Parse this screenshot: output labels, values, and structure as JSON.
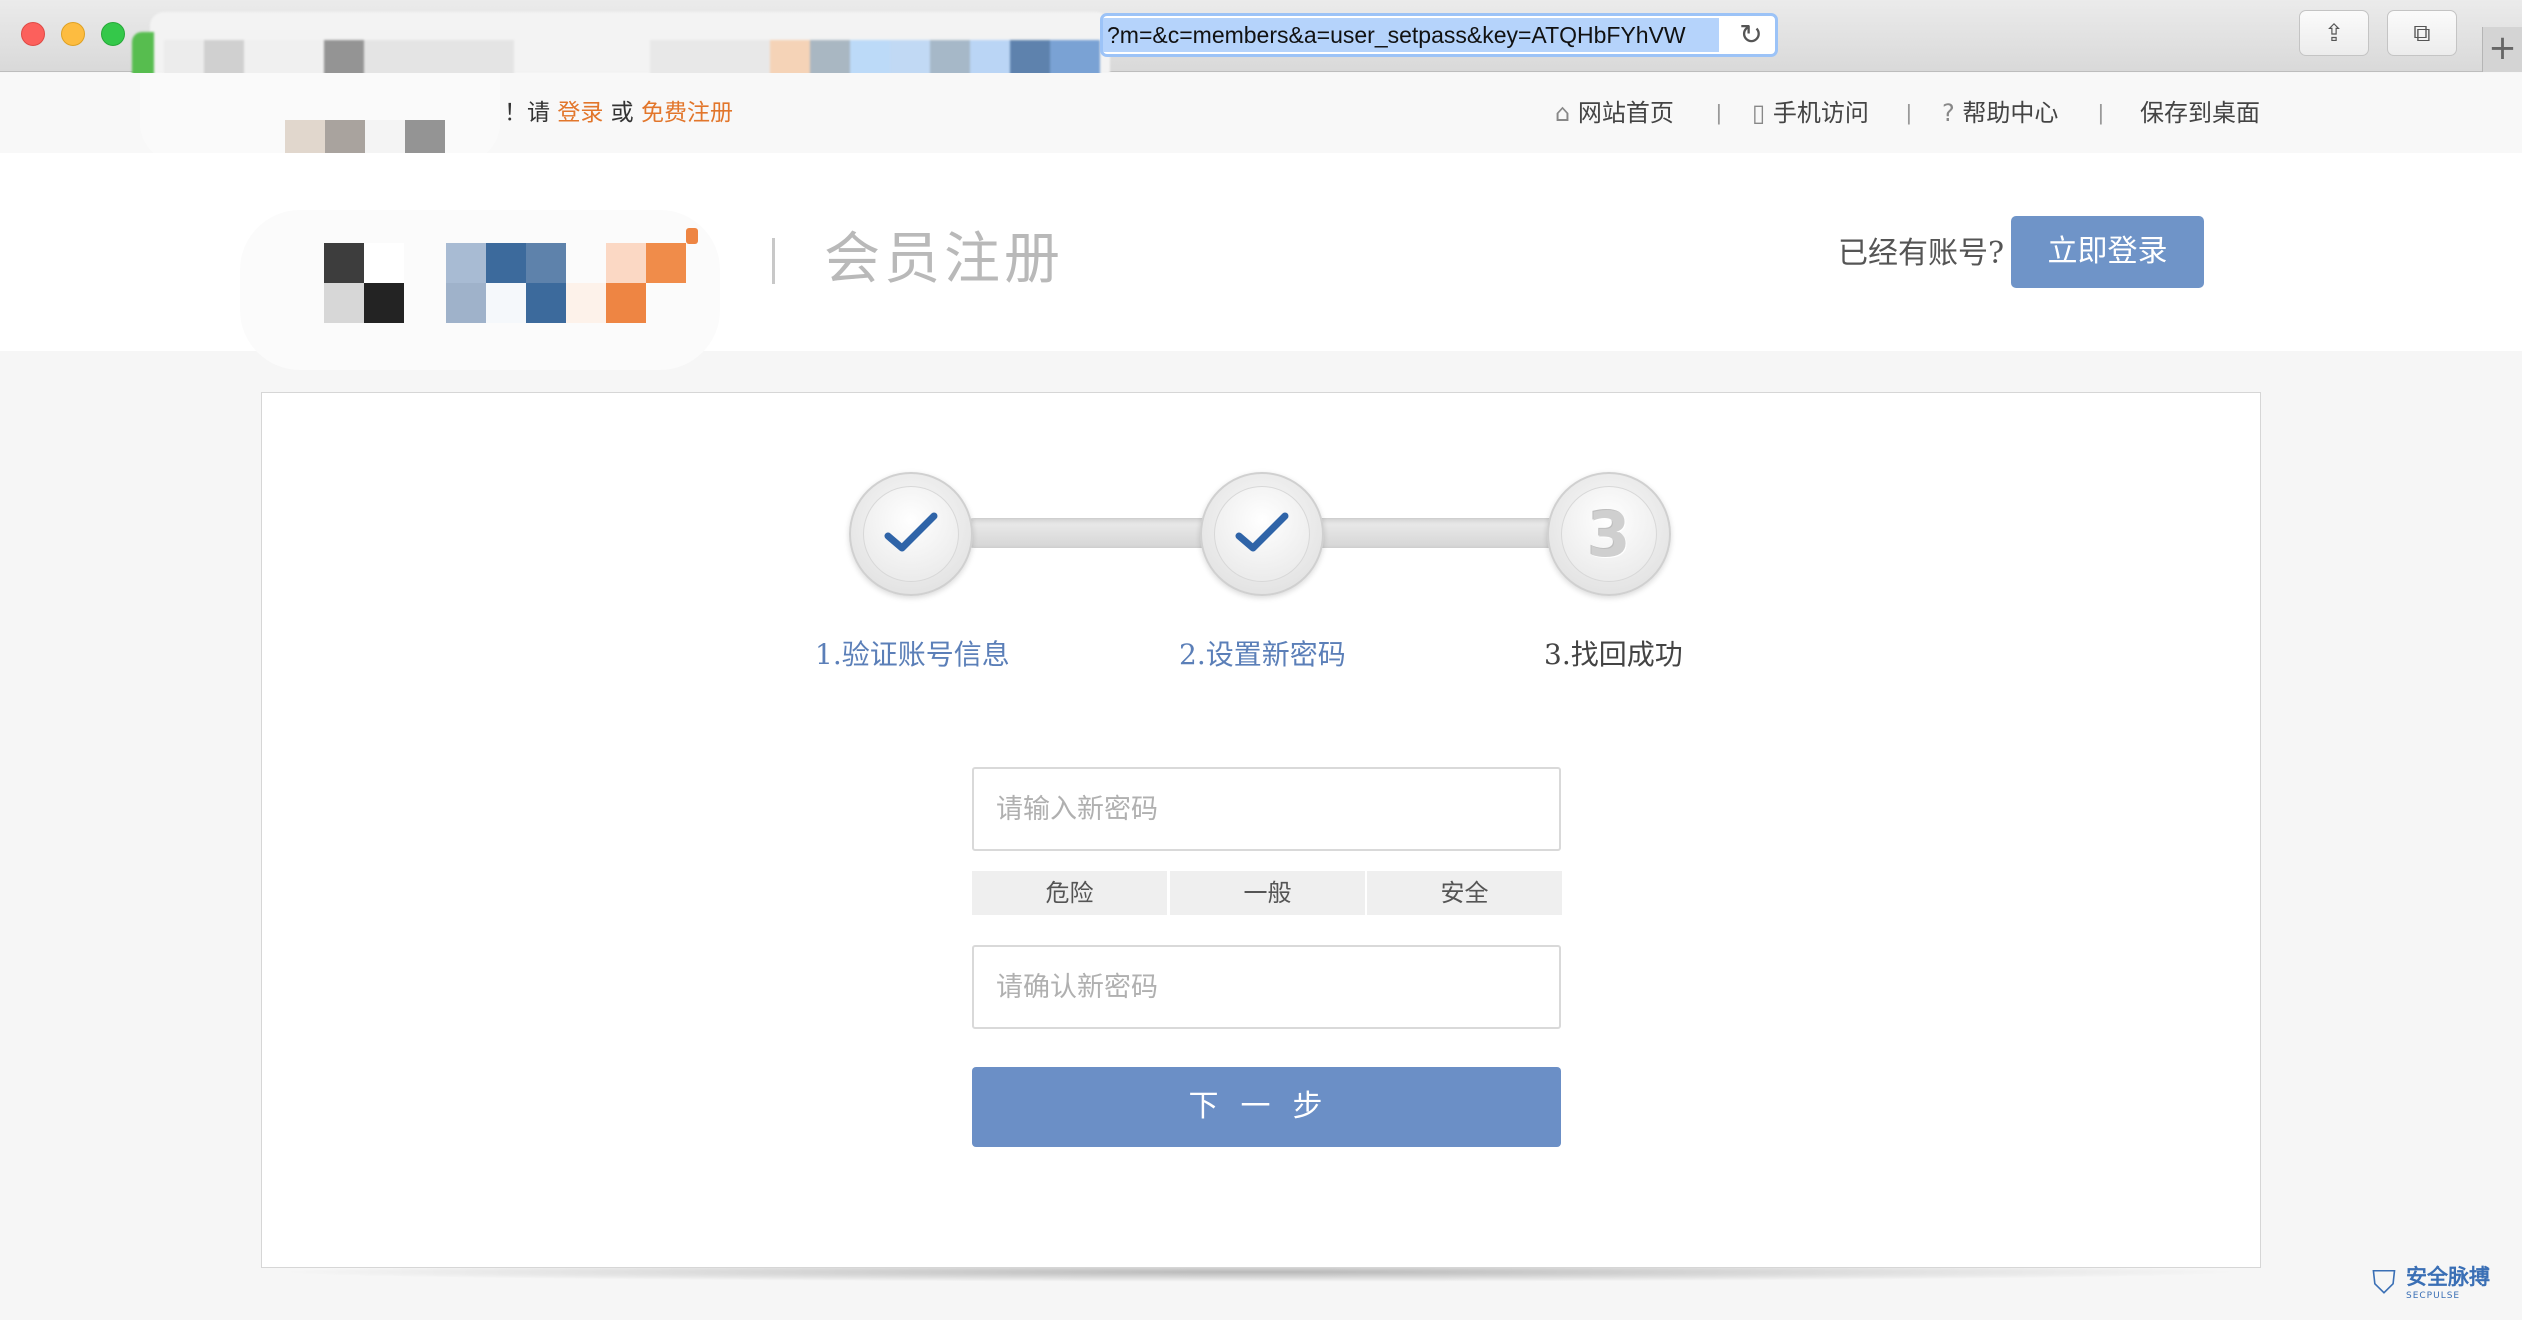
{
  "browser": {
    "url": "?m=&c=members&a=user_setpass&key=ATQHbFYhVW",
    "reload_icon": "reload-icon",
    "share_icon": "share-icon",
    "tabs_icon": "tabs-icon",
    "new_tab_icon": "plus-icon"
  },
  "topbar": {
    "welcome_prefix": "！请",
    "login_link": "登录",
    "or_text": "或",
    "register_link": "免费注册",
    "nav": [
      {
        "label": "网站首页",
        "icon": "home-icon"
      },
      {
        "label": "手机访问",
        "icon": "phone-icon"
      },
      {
        "label": "帮助中心",
        "icon": "help-icon"
      },
      {
        "label": "保存到桌面"
      }
    ],
    "separator": "|"
  },
  "header": {
    "divider": "|",
    "title": "会员注册",
    "have_account": "已经有账号?",
    "login_button": "立即登录"
  },
  "steps": [
    {
      "number": "1",
      "label": "1.验证账号信息",
      "state": "done"
    },
    {
      "number": "2",
      "label": "2.设置新密码",
      "state": "done"
    },
    {
      "number": "3",
      "label": "3.找回成功",
      "state": "current"
    }
  ],
  "form": {
    "new_password_placeholder": "请输入新密码",
    "confirm_password_placeholder": "请确认新密码",
    "strength_levels": [
      "危险",
      "一般",
      "安全"
    ],
    "next_button": "下一步"
  },
  "watermark": {
    "text": "安全脉搏",
    "sub": "SECPULSE"
  },
  "colors": {
    "accent": "#6b8fc6",
    "link_orange": "#e2762b",
    "step_done_text": "#5b7fb8",
    "check_blue": "#2f64a8"
  }
}
